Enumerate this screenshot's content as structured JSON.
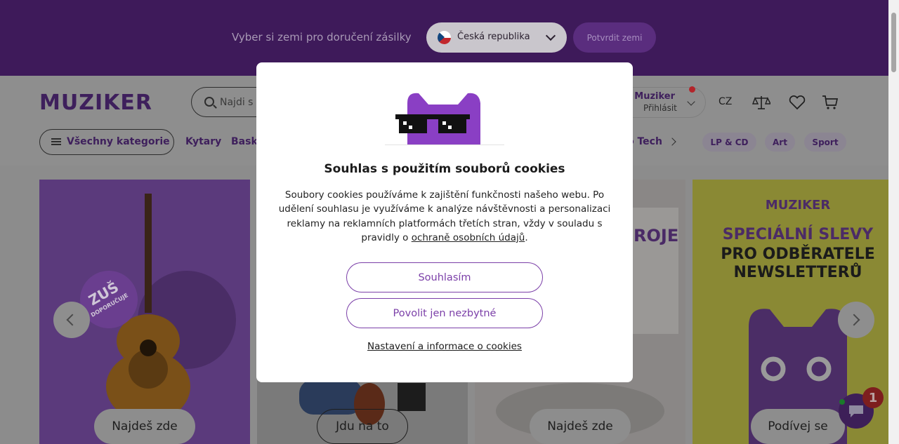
{
  "country_bar": {
    "prompt": "Vyber si zemi pro doručení zásilky",
    "selected_country": "Česká republika",
    "confirm_label": "Potvrdit zemi"
  },
  "header": {
    "logo": "MUZIKER",
    "search_placeholder": "Najdi s",
    "account_top": "a Muziker",
    "account_bottom": "Přihlásit",
    "language": "CZ",
    "icons": [
      "compare-icon",
      "heart-icon",
      "cart-icon"
    ]
  },
  "nav": {
    "all_categories": "Všechny kategorie",
    "links": [
      "Kytary",
      "Bask",
      "o Tech"
    ],
    "pills": [
      "LP & CD",
      "Art",
      "Sport"
    ]
  },
  "banners": [
    {
      "button": "Najdeš zde",
      "badge": "ZUŠ",
      "badge_sub": "DOPORUČUJE"
    },
    {
      "button": "Jdu na to"
    },
    {
      "button": "Najdeš zde",
      "heading": "ROJE"
    },
    {
      "button": "Podívej se",
      "brand": "MUZIKER",
      "line1": "SPECIÁLNÍ SLEVY",
      "line2": "PRO ODBĚRATELE",
      "line3": "NEWSLETTERŮ"
    }
  ],
  "chat": {
    "badge": "1"
  },
  "modal": {
    "title": "Souhlas s použitím souborů cookies",
    "text_before_link": "Soubory cookies používáme k zajištění funkčnosti našeho webu. Po udělení souhlasu je využíváme k analýze návštěvnosti a personalizaci reklamy na reklamních platformách třetích stran, vždy v souladu s pravidly o ",
    "link_text": "ochraně osobních údajů",
    "text_after_link": ".",
    "accept_label": "Souhlasím",
    "necessary_label": "Povolit jen nezbytné",
    "settings_label": "Nastavení a informace o cookies"
  },
  "colors": {
    "brand_purple": "#7b3fa8",
    "dark_purple": "#3e1a5a",
    "overlay": "#8c8c8c"
  }
}
